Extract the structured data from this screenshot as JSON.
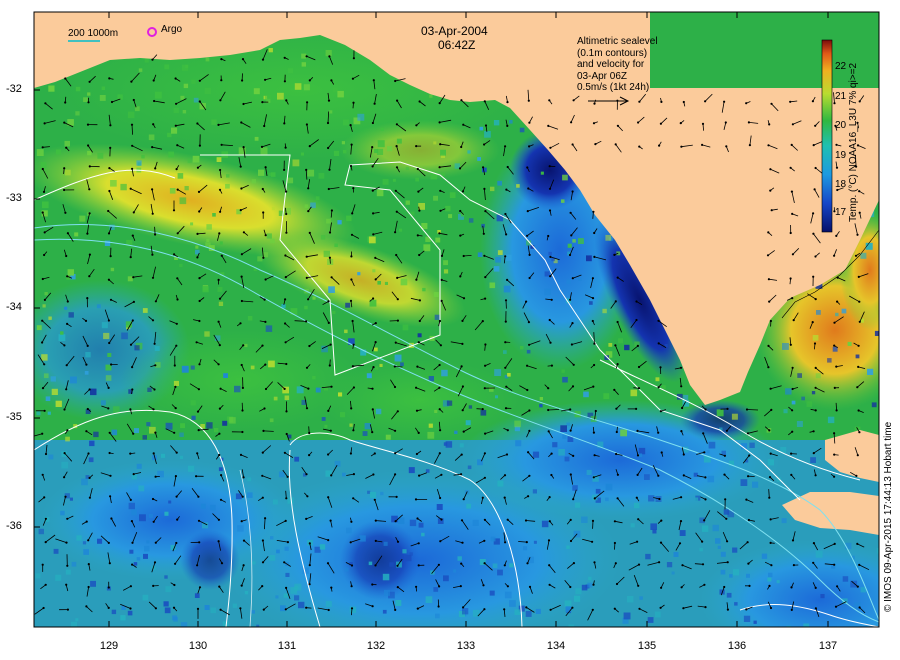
{
  "header": {
    "date": "03-Apr-2004",
    "time": "06:42Z"
  },
  "legend": {
    "scale_bar_label": "200 1000m",
    "argo_label": "Argo",
    "altimetry_lines": [
      "Altimetric sealevel",
      "(0.1m contours)",
      "and velocity for",
      "03-Apr 06Z",
      "0.5m/s (1kt 24h)"
    ]
  },
  "colorbar": {
    "title": "Temp. (°C) NOAA16_L3U 7% qi>=2",
    "ticks": [
      "22",
      "21",
      "20",
      "19",
      "18",
      "17"
    ]
  },
  "axes": {
    "lat_ticks": [
      "-32",
      "-33",
      "-34",
      "-35",
      "-36"
    ],
    "lon_ticks": [
      "129",
      "130",
      "131",
      "132",
      "133",
      "134",
      "135",
      "136",
      "137"
    ]
  },
  "credit": "© IMOS 09-Apr-2015 17:44:13 Hobart time",
  "colors": {
    "land": "#fbcb9b",
    "sea_green": "#2fb540",
    "sea_blue": "#1f86d6",
    "sea_dark": "#0a1a8a",
    "warm_yellow": "#d8e030",
    "warm_orange": "#e89a20",
    "contour": "#ffffff",
    "isobath": "#7fe0f0",
    "arrow": "#000000",
    "argo_marker": "#e020e0",
    "scale_bar": "#40c0c0"
  }
}
